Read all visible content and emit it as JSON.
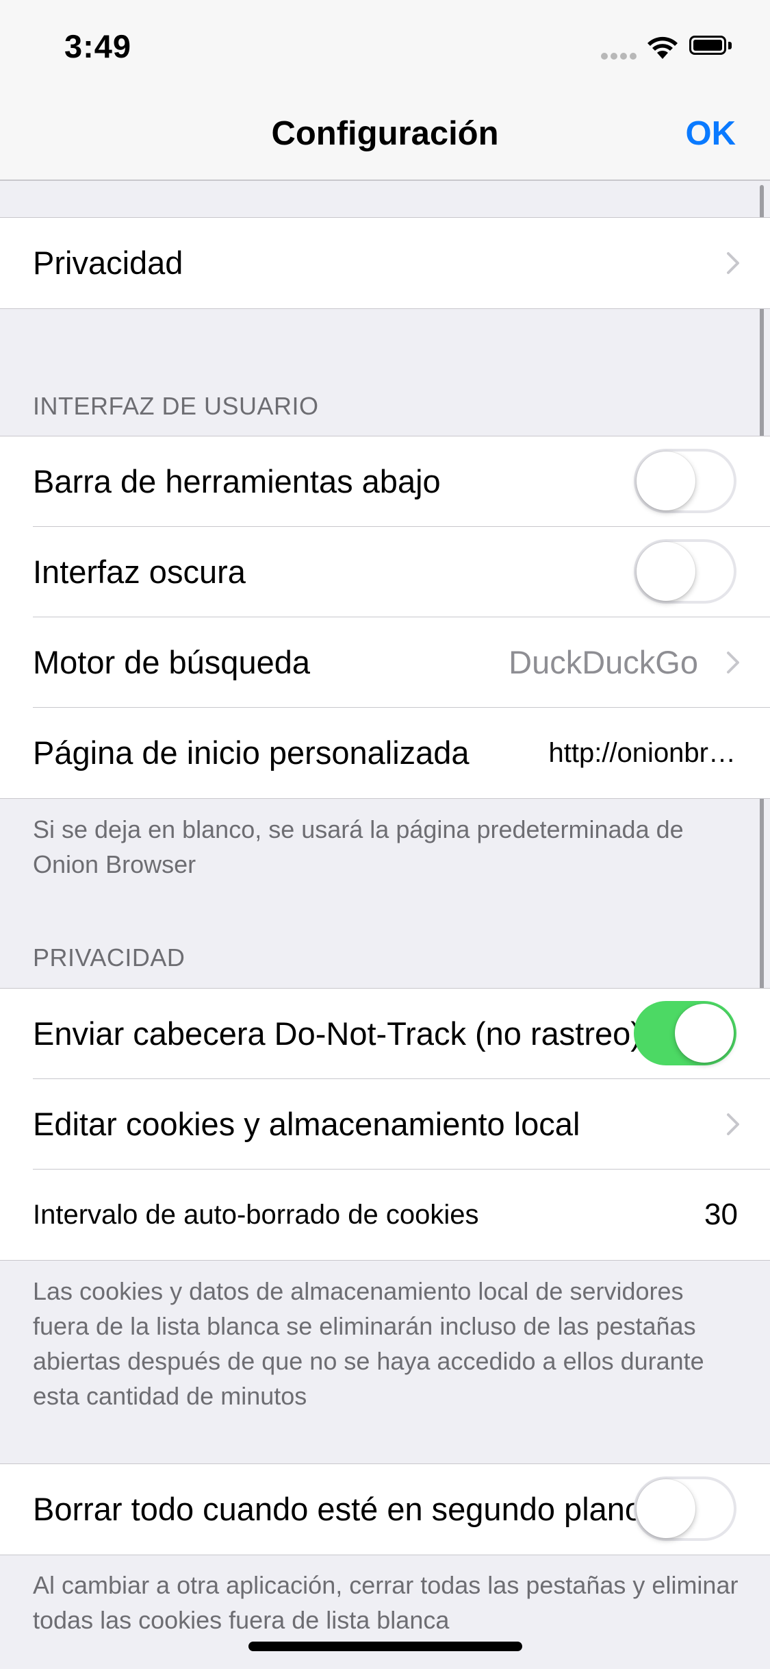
{
  "status_bar": {
    "time": "3:49"
  },
  "nav": {
    "title": "Configuración",
    "done_label": "OK"
  },
  "groups": {
    "privacy_link": {
      "label": "Privacidad"
    },
    "ui": {
      "header": "INTERFAZ DE USUARIO",
      "toolbar_bottom": {
        "label": "Barra de herramientas abajo",
        "on": false
      },
      "dark_mode": {
        "label": "Interfaz oscura",
        "on": false
      },
      "search_engine": {
        "label": "Motor de búsqueda",
        "value": "DuckDuckGo"
      },
      "homepage": {
        "label": "Página de inicio personalizada",
        "value": "http://onionbr…"
      },
      "footer": "Si se deja en blanco, se usará la página predeterminada de Onion Browser"
    },
    "privacy": {
      "header": "PRIVACIDAD",
      "dnt": {
        "label": "Enviar cabecera Do-Not-Track (no rastreo)",
        "on": true
      },
      "cookies": {
        "label": "Editar cookies y almacenamiento local"
      },
      "autosweep": {
        "label": "Intervalo de auto-borrado de cookies",
        "value": "30"
      },
      "footer": "Las cookies y datos de almacenamiento local de servidores fuera de la lista blanca se eliminarán incluso de las pestañas abiertas después de que no se haya accedido a ellos durante esta cantidad de minutos"
    },
    "background": {
      "clear_all": {
        "label": "Borrar todo cuando esté en segundo plano",
        "on": false
      },
      "footer": "Al cambiar a otra aplicación, cerrar todas las pestañas y eliminar todas las cookies fuera de lista blanca"
    }
  },
  "colors": {
    "accent": "#0a7aff",
    "toggle_on": "#4cd964",
    "background": "#efeff4"
  }
}
